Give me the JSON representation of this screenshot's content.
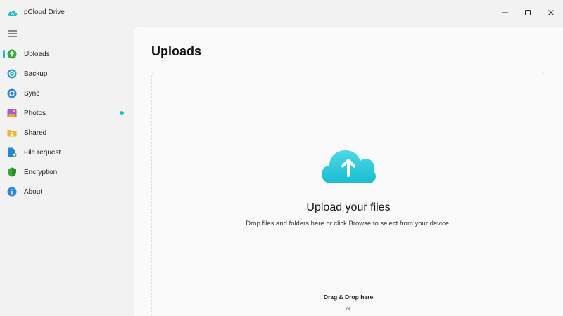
{
  "app": {
    "title": "pCloud Drive",
    "accent_color": "#17bed0"
  },
  "window_controls": {
    "minimize_icon": "minimize-icon",
    "maximize_icon": "maximize-icon",
    "close_icon": "close-icon"
  },
  "sidebar": {
    "menu_icon": "hamburger-menu-icon",
    "items": [
      {
        "label": "Uploads",
        "icon": "upload-arrow-icon",
        "active": true
      },
      {
        "label": "Backup",
        "icon": "backup-icon",
        "active": false
      },
      {
        "label": "Sync",
        "icon": "sync-icon",
        "active": false
      },
      {
        "label": "Photos",
        "icon": "photos-icon",
        "active": false,
        "notification_dot": true
      },
      {
        "label": "Shared",
        "icon": "shared-folder-icon",
        "active": false
      },
      {
        "label": "File request",
        "icon": "file-request-icon",
        "active": false
      },
      {
        "label": "Encryption",
        "icon": "shield-icon",
        "active": false
      },
      {
        "label": "About",
        "icon": "info-icon",
        "active": false
      }
    ]
  },
  "main": {
    "title": "Uploads",
    "dropzone": {
      "icon": "cloud-upload-icon",
      "heading": "Upload your files",
      "subtext": "Drop files and folders here or click Browse to select from your device.",
      "drag_drop_label": "Drag & Drop here",
      "or_label": "or"
    }
  }
}
